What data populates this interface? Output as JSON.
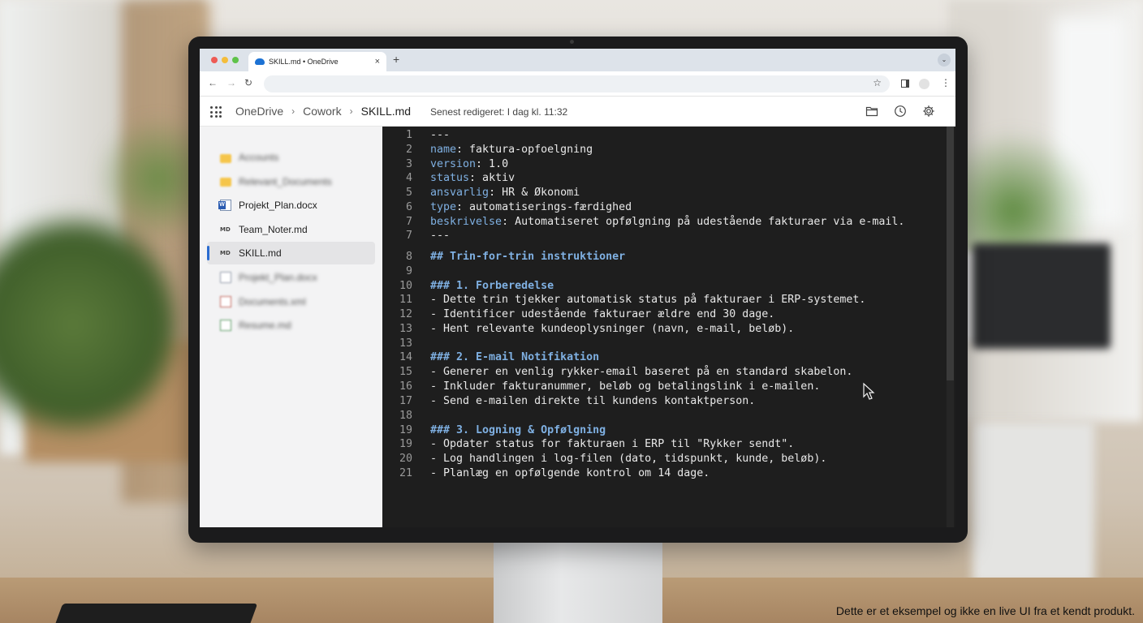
{
  "browser": {
    "tab_title": "SKILL.md • OneDrive",
    "tab_close": "×",
    "new_tab": "+",
    "tab_menu": "⌄",
    "back": "←",
    "forward": "→",
    "reload": "↻",
    "star": "☆",
    "more": "⋮"
  },
  "appbar": {
    "breadcrumbs": [
      "OneDrive",
      "Cowork",
      "SKILL.md"
    ],
    "crumb_separator": "›",
    "last_edited": "Senest redigeret: I dag kl. 11:32",
    "icons": [
      "folder-icon",
      "history-icon",
      "settings-icon"
    ]
  },
  "sidebar": {
    "files": [
      {
        "name": "Accounts",
        "icon": "folder-icon",
        "blurred": true,
        "active": false
      },
      {
        "name": "Relevant_Documents",
        "icon": "folder-icon",
        "blurred": true,
        "active": false
      },
      {
        "name": "Projekt_Plan.docx",
        "icon": "word-icon",
        "blurred": false,
        "active": false
      },
      {
        "name": "Team_Noter.md",
        "icon": "markdown-icon",
        "icon_text": "MD",
        "blurred": false,
        "active": false
      },
      {
        "name": "SKILL.md",
        "icon": "markdown-icon",
        "icon_text": "MD",
        "blurred": false,
        "active": true
      },
      {
        "name": "Projekt_Plan.docx",
        "icon": "document-icon",
        "blurred": true,
        "active": false
      },
      {
        "name": "Documents.xml",
        "icon": "xml-icon",
        "blurred": true,
        "active": false
      },
      {
        "name": "Resume.md",
        "icon": "resume-icon",
        "blurred": true,
        "active": false
      }
    ]
  },
  "editor": {
    "lines": [
      {
        "n": "1",
        "key": "",
        "text": "---",
        "style": "plain"
      },
      {
        "n": "2",
        "key": "name",
        "text": ": faktura-opfoelgning",
        "style": "kv"
      },
      {
        "n": "3",
        "key": "version",
        "text": ": 1.0",
        "style": "kv"
      },
      {
        "n": "4",
        "key": "status",
        "text": ": aktiv",
        "style": "kv"
      },
      {
        "n": "5",
        "key": "ansvarlig",
        "text": ": HR & Økonomi",
        "style": "kv"
      },
      {
        "n": "6",
        "key": "type",
        "text": ": automatiserings-færdighed",
        "style": "kv"
      },
      {
        "n": "7",
        "key": "beskrivelse",
        "text": ": Automatiseret opfølgning på udestående fakturaer via e-mail.",
        "style": "kv"
      },
      {
        "n": "7",
        "key": "",
        "text": "---",
        "style": "plain"
      },
      {
        "n": "8",
        "key": "",
        "text": "## Trin-for-trin instruktioner",
        "style": "heading"
      },
      {
        "n": "9",
        "key": "",
        "text": "",
        "style": "plain"
      },
      {
        "n": "10",
        "key": "",
        "text": "### 1. Forberedelse",
        "style": "heading"
      },
      {
        "n": "11",
        "key": "",
        "text": "- Dette trin tjekker automatisk status på fakturaer i ERP-systemet.",
        "style": "plain"
      },
      {
        "n": "12",
        "key": "",
        "text": "- Identificer udestående fakturaer ældre end 30 dage.",
        "style": "plain"
      },
      {
        "n": "13",
        "key": "",
        "text": "- Hent relevante kundeoplysninger (navn, e-mail, beløb).",
        "style": "plain"
      },
      {
        "n": "13",
        "key": "",
        "text": "",
        "style": "plain"
      },
      {
        "n": "14",
        "key": "",
        "text": "### 2. E-mail Notifikation",
        "style": "heading"
      },
      {
        "n": "15",
        "key": "",
        "text": "- Generer en venlig rykker-email baseret på en standard skabelon.",
        "style": "plain"
      },
      {
        "n": "16",
        "key": "",
        "text": "- Inkluder fakturanummer, beløb og betalingslink i e-mailen.",
        "style": "plain"
      },
      {
        "n": "17",
        "key": "",
        "text": "- Send e-mailen direkte til kundens kontaktperson.",
        "style": "plain"
      },
      {
        "n": "18",
        "key": "",
        "text": "",
        "style": "plain"
      },
      {
        "n": "19",
        "key": "",
        "text": "### 3. Logning & Opfølgning",
        "style": "heading"
      },
      {
        "n": "19",
        "key": "",
        "text": "- Opdater status for fakturaen i ERP til \"Rykker sendt\".",
        "style": "plain"
      },
      {
        "n": "20",
        "key": "",
        "text": "- Log handlingen i log-filen (dato, tidspunkt, kunde, beløb).",
        "style": "plain"
      },
      {
        "n": "21",
        "key": "",
        "text": "- Planlæg en opfølgende kontrol om 14 dage.",
        "style": "plain"
      }
    ]
  },
  "caption": "Dette er et eksempel og ikke en live UI fra et kendt produkt."
}
